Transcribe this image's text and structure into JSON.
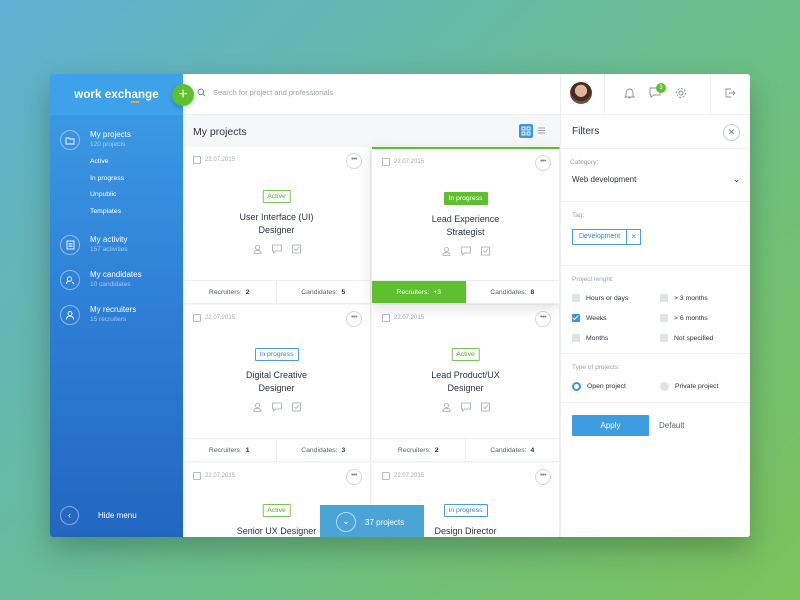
{
  "brand": {
    "name": "work exchange",
    "accent": "#f4a341",
    "green": "#5ec02f",
    "blue": "#3d95e0"
  },
  "search": {
    "placeholder": "Search for project and professionals"
  },
  "notifications": {
    "messages_badge": "3"
  },
  "sidebar": {
    "items": [
      {
        "label": "My projects",
        "sub": "120 projects",
        "icon": "folder-icon"
      },
      {
        "label": "My activity",
        "sub": "157 activities",
        "icon": "document-icon"
      },
      {
        "label": "My candidates",
        "sub": "10 candidates",
        "icon": "candidate-search-icon"
      },
      {
        "label": "My recruiters",
        "sub": "15 recruiters",
        "icon": "recruiter-icon"
      }
    ],
    "subitems": [
      "Active",
      "In progress",
      "Unpublic",
      "Templates"
    ],
    "hide_menu": "Hide menu"
  },
  "main": {
    "title": "My projects",
    "cards": [
      {
        "date": "22.07.2015",
        "status": "Active",
        "title1": "User Interface (UI)",
        "title2": "Designer",
        "recruiters_label": "Recruiters:",
        "recruiters": "2",
        "candidates_label": "Candidates:",
        "candidates": "5"
      },
      {
        "date": "22.07.2015",
        "status": "In progress",
        "title1": "Lead Experience",
        "title2": "Strategist",
        "recruiters_label": "Recruiters:",
        "recruiters": "+3",
        "candidates_label": "Candidates:",
        "candidates": "8"
      },
      {
        "date": "22.07.2015",
        "status": "In progress",
        "title1": "Digital Creative",
        "title2": "Designer",
        "recruiters_label": "Recruiters:",
        "recruiters": "1",
        "candidates_label": "Candidates:",
        "candidates": "3"
      },
      {
        "date": "22.07.2015",
        "status": "Active",
        "title1": "Lead Product/UX",
        "title2": "Designer",
        "recruiters_label": "Recruiters:",
        "recruiters": "2",
        "candidates_label": "Candidates:",
        "candidates": "4"
      },
      {
        "date": "22.07.2015",
        "status": "Active",
        "title1": "Senior UX Designer",
        "title2": ""
      },
      {
        "date": "22.07.2015",
        "status": "In progress",
        "title1": "Design Director",
        "title2": ""
      }
    ],
    "count_button": "37 projects"
  },
  "filters": {
    "title": "Filters",
    "category_label": "Category:",
    "category_value": "Web development",
    "tag_label": "Tag:",
    "tag_value": "Development",
    "length_label": "Project lenght:",
    "length_options": [
      {
        "label": "Hours or days",
        "checked": false
      },
      {
        "label": "> 3 months",
        "checked": false
      },
      {
        "label": "Weeks",
        "checked": true
      },
      {
        "label": "> 6 months",
        "checked": false
      },
      {
        "label": "Months",
        "checked": false
      },
      {
        "label": "Not specified",
        "checked": false
      }
    ],
    "type_label": "Type of projects:",
    "type_options": [
      {
        "label": "Open project",
        "selected": true
      },
      {
        "label": "Private project",
        "selected": false
      }
    ],
    "apply": "Apply",
    "default": "Default"
  }
}
